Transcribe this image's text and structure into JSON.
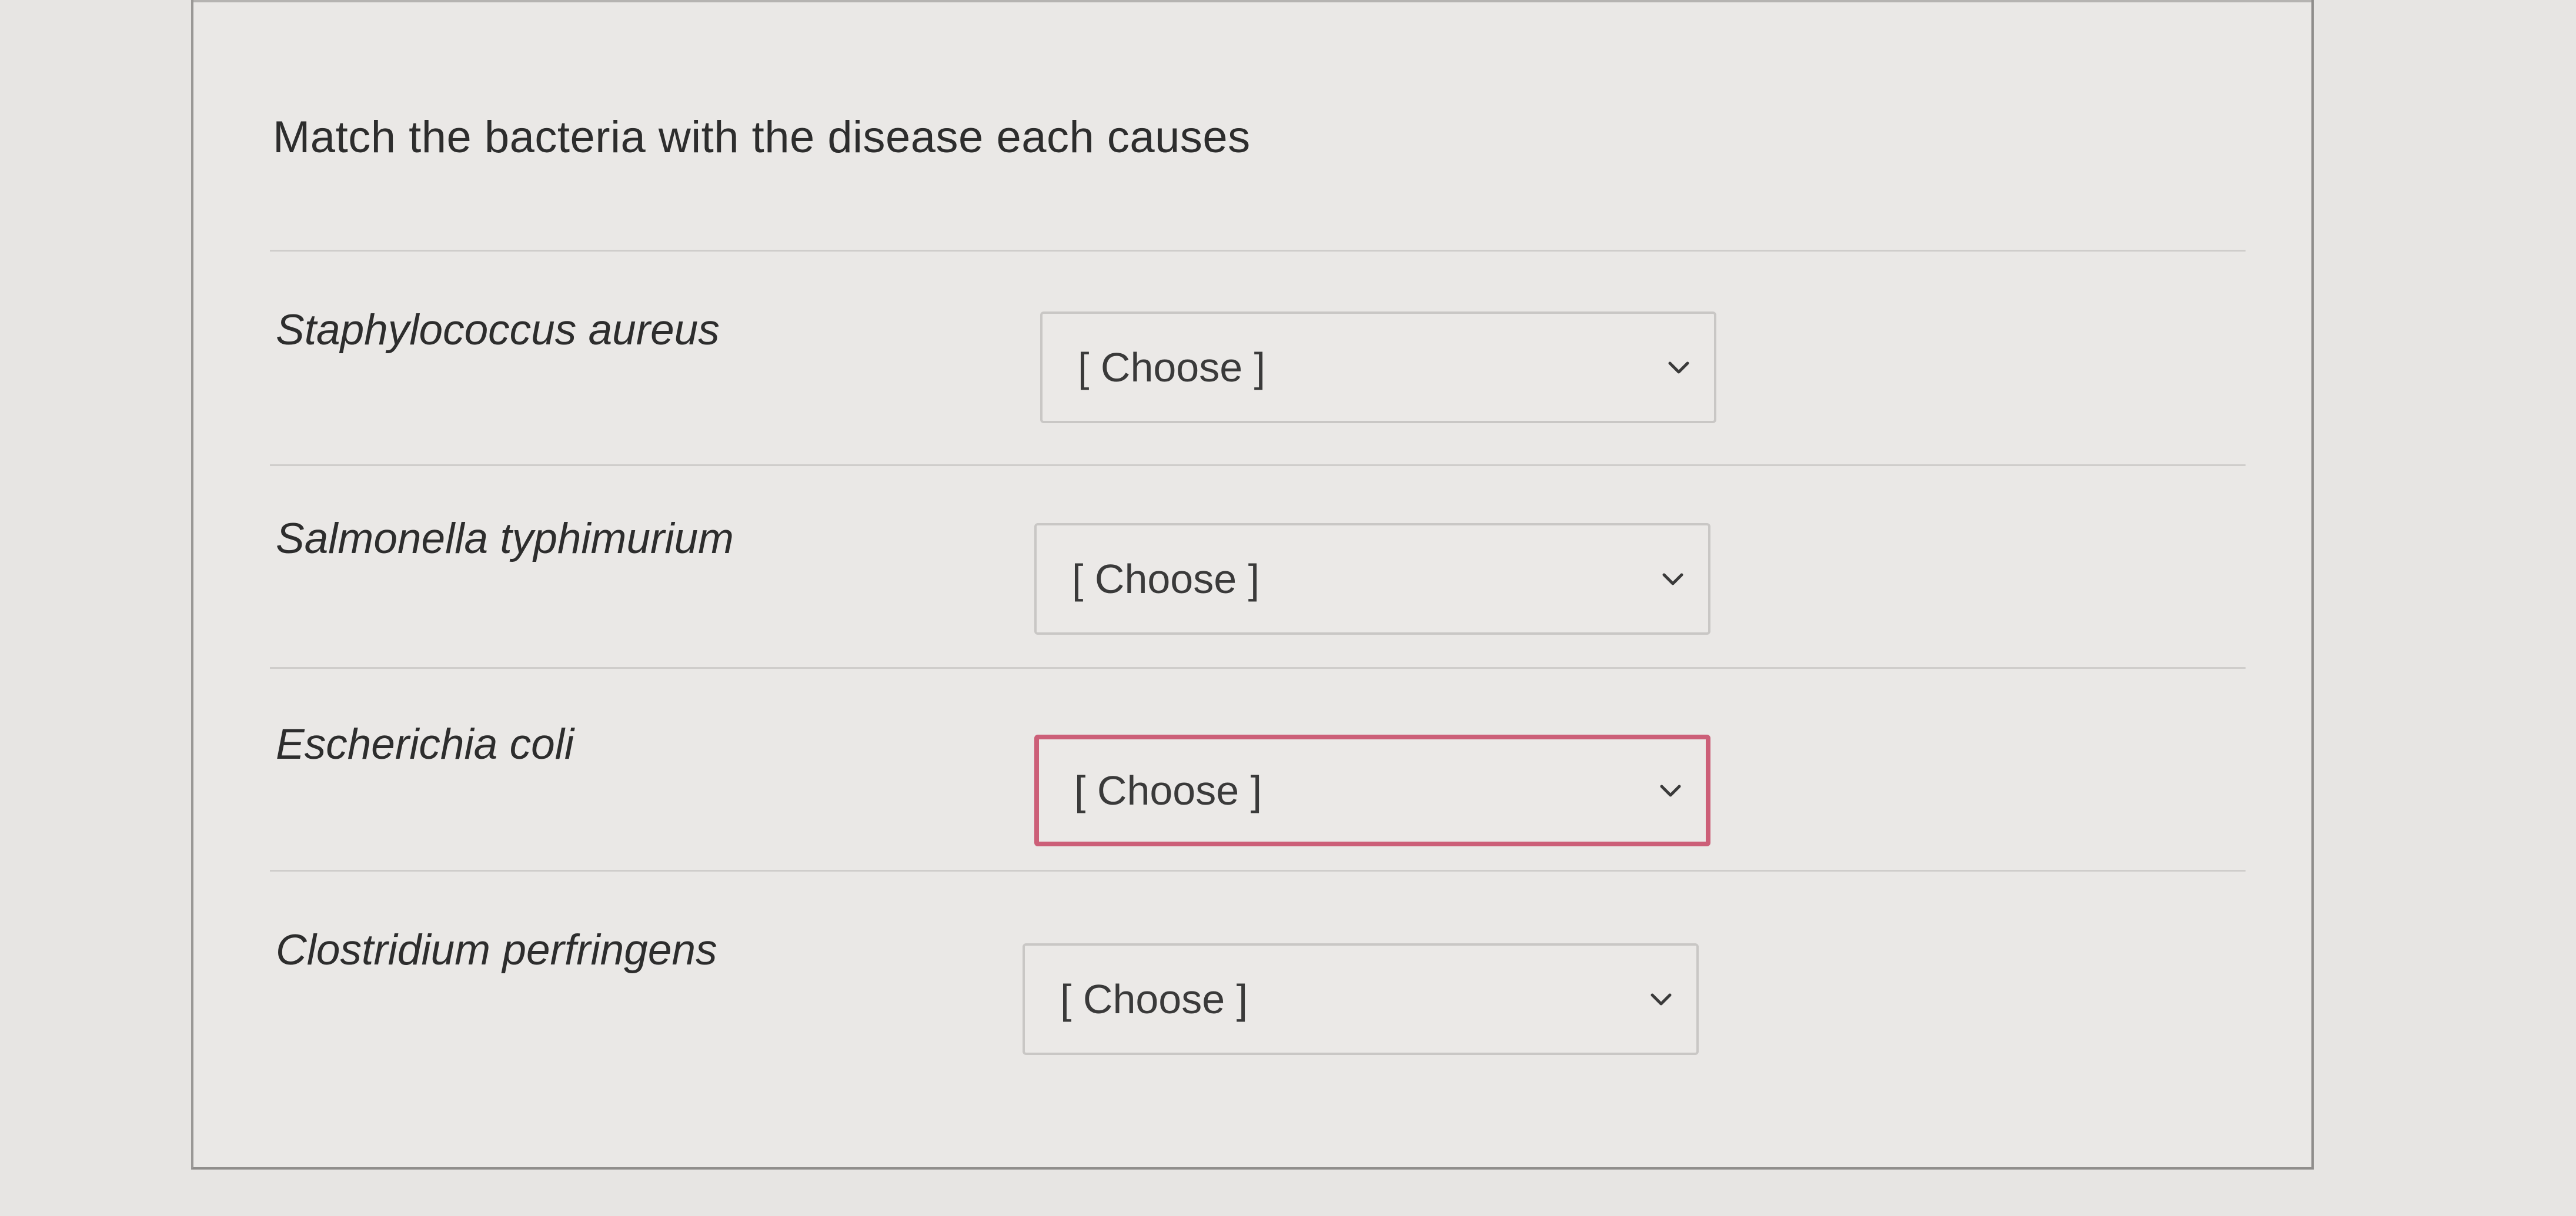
{
  "question": {
    "text": "Match the bacteria with the disease each causes"
  },
  "rows": [
    {
      "label": "Staphylococcus aureus",
      "select_value": "[ Choose ]",
      "error": false,
      "chevron_icon": "chevron-down-icon"
    },
    {
      "label": "Salmonella typhimurium",
      "select_value": "[ Choose ]",
      "error": false,
      "chevron_icon": "chevron-down-icon"
    },
    {
      "label": "Escherichia coli",
      "select_value": "[ Choose ]",
      "error": true,
      "chevron_icon": "chevron-down-icon"
    },
    {
      "label": "Clostridium perfringens",
      "select_value": "[ Choose ]",
      "error": false,
      "chevron_icon": "chevron-down-icon"
    }
  ],
  "colors": {
    "background": "#e7e5e3",
    "panel": "#eae8e6",
    "text": "#2d2d2d",
    "error_border": "#cc5f78",
    "divider": "#cfcdcb"
  }
}
